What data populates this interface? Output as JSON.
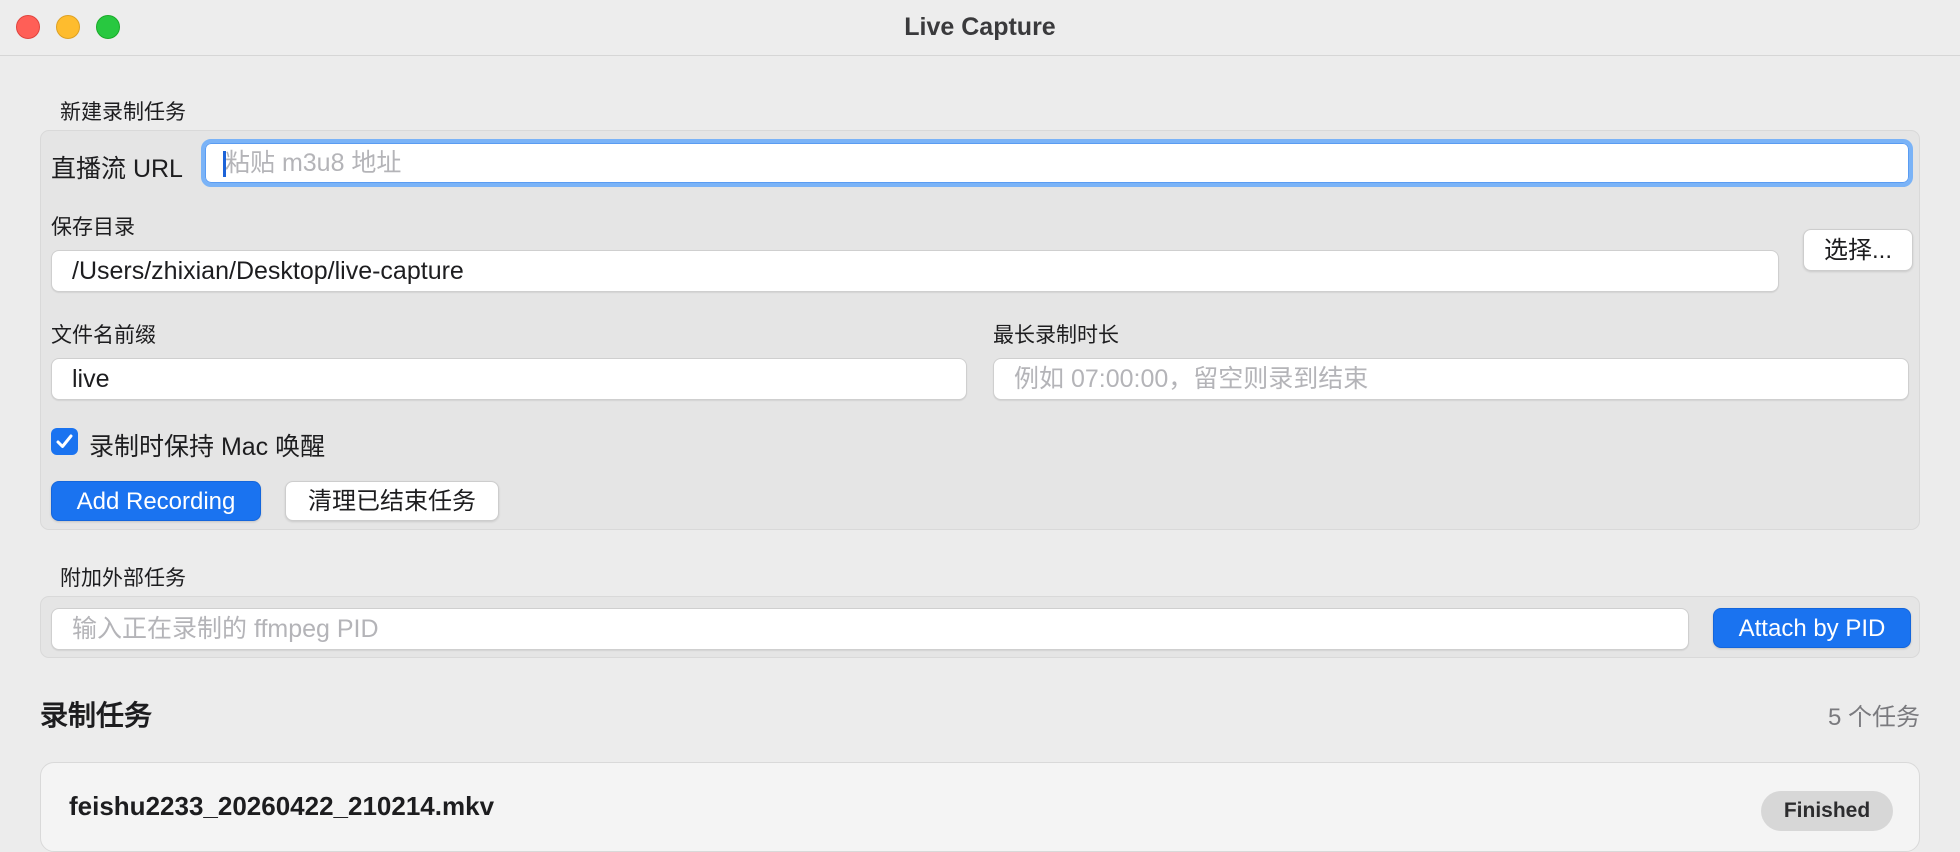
{
  "window": {
    "title": "Live Capture"
  },
  "new_task": {
    "section_title": "新建录制任务",
    "url_label": "直播流 URL",
    "url_value": "",
    "url_placeholder": "粘贴 m3u8 地址",
    "save_dir_label": "保存目录",
    "save_dir_value": "/Users/zhixian/Desktop/live-capture",
    "choose_button": "选择...",
    "prefix_label": "文件名前缀",
    "prefix_value": "live",
    "max_duration_label": "最长录制时长",
    "max_duration_value": "",
    "max_duration_placeholder": "例如 07:00:00，留空则录到结束",
    "keep_awake_label": "录制时保持 Mac 唤醒",
    "keep_awake_checked": true,
    "add_button": "Add Recording",
    "clear_button": "清理已结束任务"
  },
  "attach": {
    "section_title": "附加外部任务",
    "pid_value": "",
    "pid_placeholder": "输入正在录制的 ffmpeg PID",
    "attach_button": "Attach by PID"
  },
  "tasks": {
    "header": "录制任务",
    "count_label": "5 个任务",
    "items": [
      {
        "filename": "feishu2233_20260422_210214.mkv",
        "status": "Finished"
      }
    ]
  },
  "colors": {
    "accent": "#1a73f0",
    "window_bg": "#ececec",
    "group_bg": "#e5e5e5",
    "close": "#ff5f57",
    "minimize": "#febc2e",
    "zoom": "#28c840"
  }
}
